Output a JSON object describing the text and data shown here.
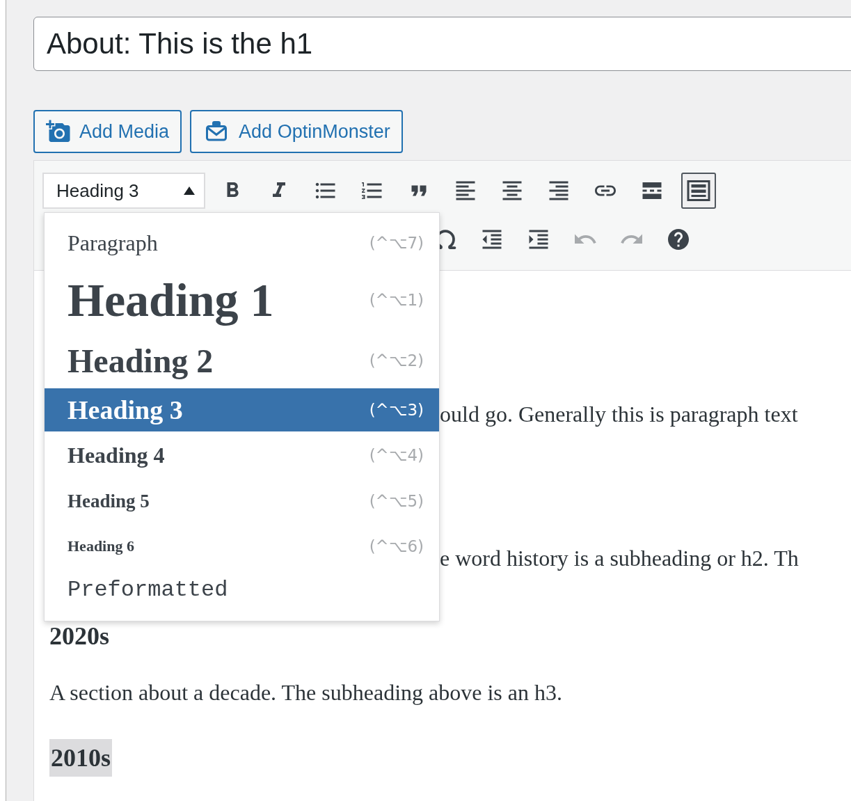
{
  "title_field": {
    "value": "About: This is the h1"
  },
  "media_buttons": [
    {
      "kind": "media",
      "label": "Add Media"
    },
    {
      "kind": "optin",
      "label": "Add OptinMonster"
    }
  ],
  "toolbar": {
    "format_select": {
      "value": "Heading 3",
      "expanded": true
    },
    "row_1": [
      {
        "kind": "bold"
      },
      {
        "kind": "italic"
      },
      {
        "kind": "bullets"
      },
      {
        "kind": "numbers"
      },
      {
        "kind": "quote"
      },
      {
        "kind": "align-left"
      },
      {
        "kind": "align-center"
      },
      {
        "kind": "align-right"
      },
      {
        "kind": "link"
      },
      {
        "kind": "more"
      },
      {
        "kind": "kitchen-sink",
        "pressed": true
      }
    ],
    "row_2": [
      {
        "kind": "omega",
        "disabled": false
      },
      {
        "kind": "outdent",
        "disabled": false
      },
      {
        "kind": "indent",
        "disabled": false
      },
      {
        "kind": "undo",
        "disabled": true
      },
      {
        "kind": "redo",
        "disabled": true
      },
      {
        "kind": "help",
        "disabled": false
      }
    ]
  },
  "format_menu": [
    {
      "kind": "p",
      "label": "Paragraph",
      "shortcut": "(^⌥7)",
      "selected": false
    },
    {
      "kind": "h1",
      "label": "Heading 1",
      "shortcut": "(^⌥1)",
      "selected": false
    },
    {
      "kind": "h2",
      "label": "Heading 2",
      "shortcut": "(^⌥2)",
      "selected": false
    },
    {
      "kind": "h3",
      "label": "Heading 3",
      "shortcut": "(^⌥3)",
      "selected": true
    },
    {
      "kind": "h4",
      "label": "Heading 4",
      "shortcut": "(^⌥4)",
      "selected": false
    },
    {
      "kind": "h5",
      "label": "Heading 5",
      "shortcut": "(^⌥5)",
      "selected": false
    },
    {
      "kind": "h6",
      "label": "Heading 6",
      "shortcut": "(^⌥6)",
      "selected": false
    },
    {
      "kind": "pre",
      "label": "Preformatted",
      "selected": false
    }
  ],
  "content": [
    {
      "kind": "paragraph",
      "text": "ould go. Generally this is paragraph text",
      "covered": true
    },
    {
      "kind": "paragraph",
      "text": "e word history is a subheading or h2. Th",
      "covered": true
    },
    {
      "kind": "h3",
      "text": "2020s",
      "covered": false
    },
    {
      "kind": "paragraph",
      "text": "A section about a decade. The subheading above is an h3.",
      "covered": false
    },
    {
      "kind": "h3",
      "text": "2010s",
      "covered": false,
      "highlighted": true
    }
  ]
}
